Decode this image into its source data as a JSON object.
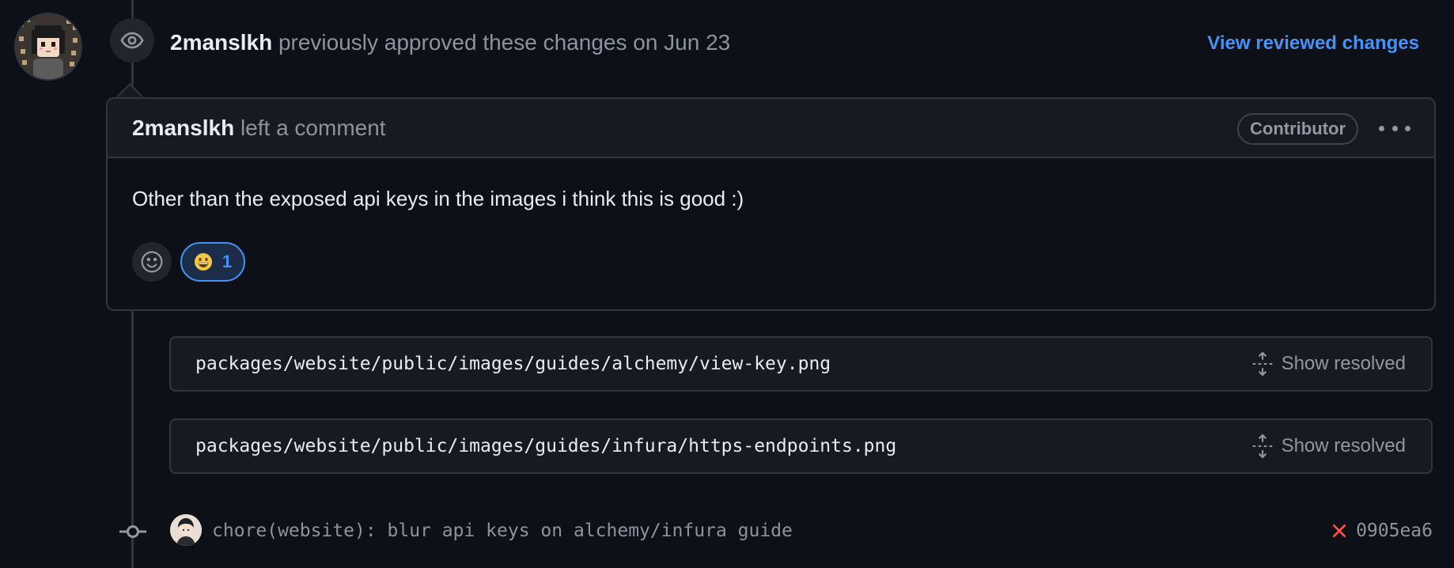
{
  "review": {
    "username": "2manslkh",
    "action_text": "previously approved these changes on Jun 23",
    "view_link": "View reviewed changes"
  },
  "comment": {
    "username": "2manslkh",
    "action_text": "left a comment",
    "badge": "Contributor",
    "body": "Other than the exposed api keys in the images i think this is good :)",
    "reaction": {
      "emoji": "grinning-face",
      "count": "1"
    }
  },
  "resolved_threads": [
    {
      "path": "packages/website/public/images/guides/alchemy/view-key.png",
      "action": "Show resolved"
    },
    {
      "path": "packages/website/public/images/guides/infura/https-endpoints.png",
      "action": "Show resolved"
    }
  ],
  "commit": {
    "message": "chore(website): blur api keys on alchemy/infura guide",
    "sha": "0905ea6",
    "status": "failed"
  },
  "colors": {
    "background": "#0d1117",
    "link": "#4493f8",
    "muted": "#8b949e",
    "failure": "#f85149",
    "border": "#30363d"
  }
}
